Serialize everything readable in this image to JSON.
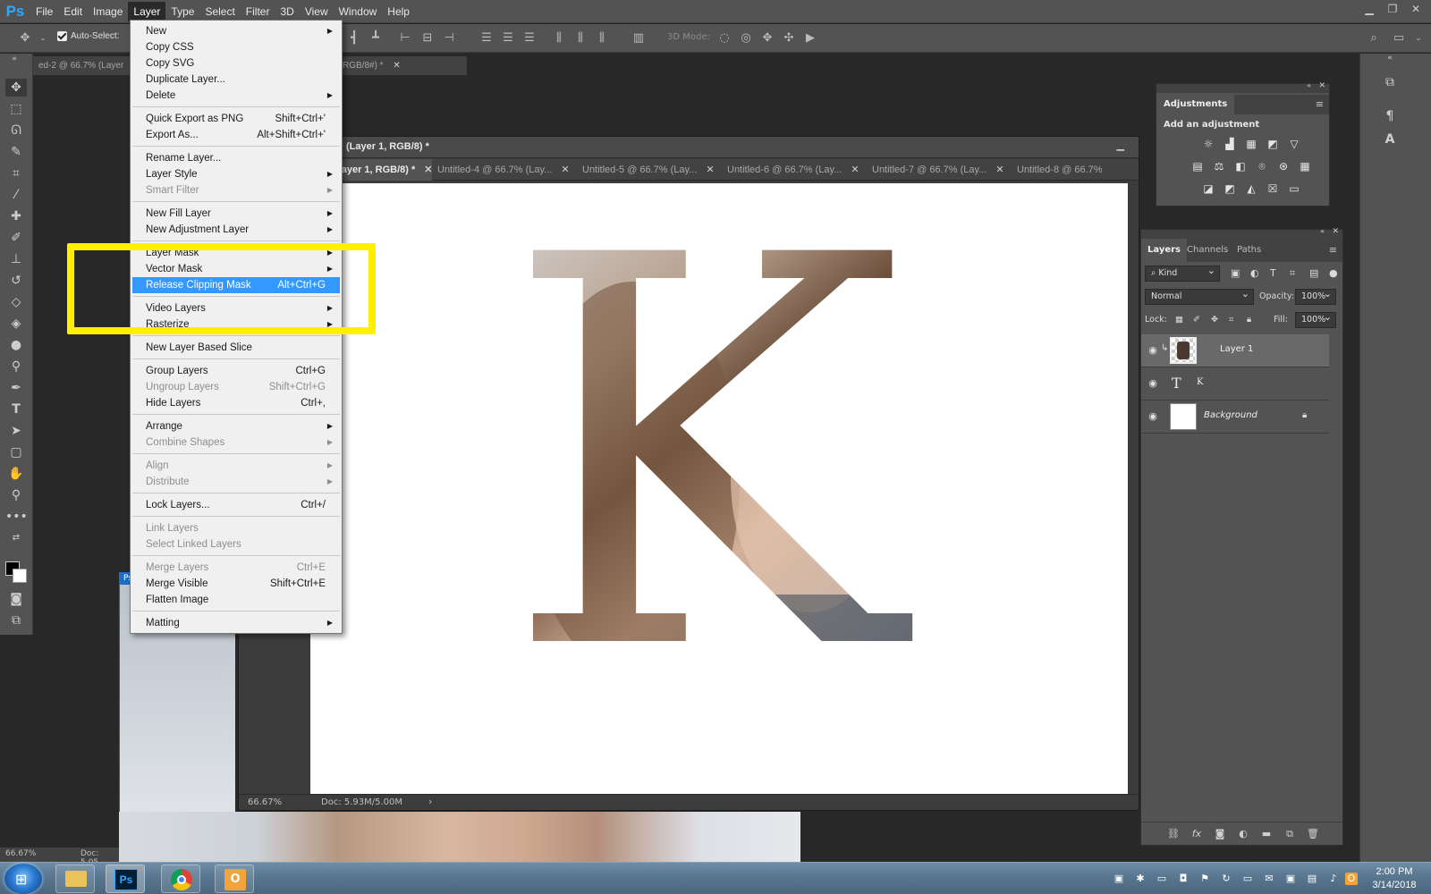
{
  "app": {
    "logo": "Ps"
  },
  "menubar": {
    "items": [
      "File",
      "Edit",
      "Image",
      "Layer",
      "Type",
      "Select",
      "Filter",
      "3D",
      "View",
      "Window",
      "Help"
    ],
    "active": "Layer"
  },
  "options_bar": {
    "auto_select_label": "Auto-Select:",
    "mode_3d_label": "3D Mode:"
  },
  "back_doc": {
    "tab1": "ed-2 @ 66.7% (Layer",
    "tab2": "RGB/8#) *"
  },
  "float_window": {
    "title": "(Layer 1, RGB/8) *",
    "tabs": [
      {
        "label": "Layer 1, RGB/8) *",
        "active": true
      },
      {
        "label": "Untitled-4 @ 66.7% (Lay...",
        "active": false
      },
      {
        "label": "Untitled-5 @ 66.7% (Lay...",
        "active": false
      },
      {
        "label": "Untitled-6 @ 66.7% (Lay...",
        "active": false
      },
      {
        "label": "Untitled-7 @ 66.7% (Lay...",
        "active": false
      },
      {
        "label": "Untitled-8 @ 66.7% (Lay...",
        "active": false
      }
    ],
    "zoom": "66.67%",
    "doc_info": "Doc: 5.93M/5.00M",
    "canvas_letter": "K"
  },
  "old_status": {
    "zoom": "66.67%",
    "doc": "Doc: 5.05"
  },
  "layer_menu": {
    "items": [
      {
        "label": "New",
        "submenu": true
      },
      {
        "label": "Copy CSS"
      },
      {
        "label": "Copy SVG"
      },
      {
        "label": "Duplicate Layer..."
      },
      {
        "label": "Delete",
        "submenu": true
      },
      {
        "sep": true
      },
      {
        "label": "Quick Export as PNG",
        "shortcut": "Shift+Ctrl+'"
      },
      {
        "label": "Export As...",
        "shortcut": "Alt+Shift+Ctrl+'"
      },
      {
        "sep": true
      },
      {
        "label": "Rename Layer..."
      },
      {
        "label": "Layer Style",
        "submenu": true
      },
      {
        "label": "Smart Filter",
        "submenu": true,
        "disabled": true
      },
      {
        "sep": true
      },
      {
        "label": "New Fill Layer",
        "submenu": true
      },
      {
        "label": "New Adjustment Layer",
        "submenu": true
      },
      {
        "sep": true
      },
      {
        "label": "Layer Mask",
        "submenu": true
      },
      {
        "label": "Vector Mask",
        "submenu": true
      },
      {
        "label": "Release Clipping Mask",
        "shortcut": "Alt+Ctrl+G",
        "highlight": true
      },
      {
        "sep": true
      },
      {
        "label": "Video Layers",
        "submenu": true
      },
      {
        "label": "Rasterize",
        "submenu": true
      },
      {
        "sep": true
      },
      {
        "label": "New Layer Based Slice"
      },
      {
        "sep": true
      },
      {
        "label": "Group Layers",
        "shortcut": "Ctrl+G"
      },
      {
        "label": "Ungroup Layers",
        "shortcut": "Shift+Ctrl+G",
        "disabled": true
      },
      {
        "label": "Hide Layers",
        "shortcut": "Ctrl+,"
      },
      {
        "sep": true
      },
      {
        "label": "Arrange",
        "submenu": true
      },
      {
        "label": "Combine Shapes",
        "submenu": true,
        "disabled": true
      },
      {
        "sep": true
      },
      {
        "label": "Align",
        "submenu": true,
        "disabled": true
      },
      {
        "label": "Distribute",
        "submenu": true,
        "disabled": true
      },
      {
        "sep": true
      },
      {
        "label": "Lock Layers...",
        "shortcut": "Ctrl+/"
      },
      {
        "sep": true
      },
      {
        "label": "Link Layers",
        "disabled": true
      },
      {
        "label": "Select Linked Layers",
        "disabled": true
      },
      {
        "sep": true
      },
      {
        "label": "Merge Layers",
        "shortcut": "Ctrl+E",
        "disabled": true
      },
      {
        "label": "Merge Visible",
        "shortcut": "Shift+Ctrl+E"
      },
      {
        "label": "Flatten Image"
      },
      {
        "sep": true
      },
      {
        "label": "Matting",
        "submenu": true
      }
    ]
  },
  "adjustments": {
    "tab": "Adjustments",
    "subtitle": "Add an adjustment"
  },
  "layers_panel": {
    "tabs": [
      "Layers",
      "Channels",
      "Paths"
    ],
    "filter_kind": "Kind",
    "blend_mode": "Normal",
    "opacity_label": "Opacity:",
    "opacity": "100%",
    "lock_label": "Lock:",
    "fill_label": "Fill:",
    "fill": "100%",
    "layers": [
      {
        "name": "Layer 1",
        "kind": "pixel",
        "selected": true,
        "clipped": true
      },
      {
        "name": "K",
        "kind": "type",
        "selected": false
      },
      {
        "name": "Background",
        "kind": "background",
        "selected": false,
        "locked": true
      }
    ]
  },
  "taskbar": {
    "apps": [
      "start-button",
      "file-explorer",
      "photoshop",
      "chrome",
      "outlook"
    ],
    "time": "2:00 PM",
    "date": "3/14/2018"
  }
}
